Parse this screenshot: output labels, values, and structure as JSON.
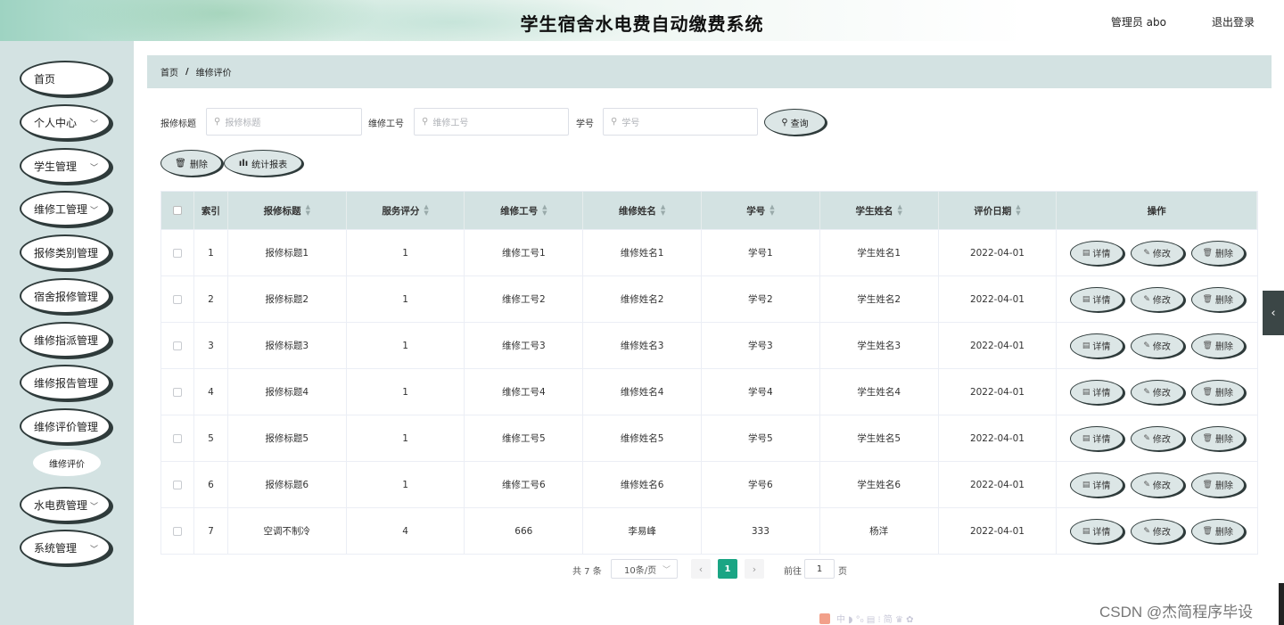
{
  "header": {
    "title": "学生宿舍水电费自动缴费系统",
    "user_label": "管理员 abo",
    "logout_label": "退出登录"
  },
  "sidebar": {
    "items": [
      {
        "label": "首页",
        "has_submenu": false
      },
      {
        "label": "个人中心",
        "has_submenu": true
      },
      {
        "label": "学生管理",
        "has_submenu": true
      },
      {
        "label": "维修工管理",
        "has_submenu": true
      },
      {
        "label": "报修类别管理",
        "has_submenu": false
      },
      {
        "label": "宿舍报修管理",
        "has_submenu": false
      },
      {
        "label": "维修指派管理",
        "has_submenu": false
      },
      {
        "label": "维修报告管理",
        "has_submenu": false
      },
      {
        "label": "维修评价管理",
        "has_submenu": false
      },
      {
        "label": "水电费管理",
        "has_submenu": true
      },
      {
        "label": "系统管理",
        "has_submenu": true
      }
    ],
    "active_subitem": "维修评价"
  },
  "breadcrumb": {
    "home": "首页",
    "separator": "/",
    "current": "维修评价"
  },
  "search": {
    "field1_label": "报修标题",
    "field1_placeholder": "报修标题",
    "field2_label": "维修工号",
    "field2_placeholder": "维修工号",
    "field3_label": "学号",
    "field3_placeholder": "学号",
    "query_button": "查询"
  },
  "toolbar": {
    "delete_button": "删除",
    "report_button": "统计报表"
  },
  "table": {
    "columns": [
      "索引",
      "报修标题",
      "服务评分",
      "维修工号",
      "维修姓名",
      "学号",
      "学生姓名",
      "评价日期",
      "操作"
    ],
    "rows": [
      {
        "index": "1",
        "title": "报修标题1",
        "score": "1",
        "worker_id": "维修工号1",
        "worker_name": "维修姓名1",
        "student_id": "学号1",
        "student_name": "学生姓名1",
        "date": "2022-04-01"
      },
      {
        "index": "2",
        "title": "报修标题2",
        "score": "1",
        "worker_id": "维修工号2",
        "worker_name": "维修姓名2",
        "student_id": "学号2",
        "student_name": "学生姓名2",
        "date": "2022-04-01"
      },
      {
        "index": "3",
        "title": "报修标题3",
        "score": "1",
        "worker_id": "维修工号3",
        "worker_name": "维修姓名3",
        "student_id": "学号3",
        "student_name": "学生姓名3",
        "date": "2022-04-01"
      },
      {
        "index": "4",
        "title": "报修标题4",
        "score": "1",
        "worker_id": "维修工号4",
        "worker_name": "维修姓名4",
        "student_id": "学号4",
        "student_name": "学生姓名4",
        "date": "2022-04-01"
      },
      {
        "index": "5",
        "title": "报修标题5",
        "score": "1",
        "worker_id": "维修工号5",
        "worker_name": "维修姓名5",
        "student_id": "学号5",
        "student_name": "学生姓名5",
        "date": "2022-04-01"
      },
      {
        "index": "6",
        "title": "报修标题6",
        "score": "1",
        "worker_id": "维修工号6",
        "worker_name": "维修姓名6",
        "student_id": "学号6",
        "student_name": "学生姓名6",
        "date": "2022-04-01"
      },
      {
        "index": "7",
        "title": "空调不制冷",
        "score": "4",
        "worker_id": "666",
        "worker_name": "李易峰",
        "student_id": "333",
        "student_name": "杨洋",
        "date": "2022-04-01"
      }
    ],
    "actions": {
      "detail": "详情",
      "edit": "修改",
      "delete": "删除"
    }
  },
  "pagination": {
    "total": "共 7 条",
    "page_size": "10条/页",
    "current_page": "1",
    "goto_label": "前往",
    "goto_value": "1",
    "page_suffix": "页"
  },
  "watermark": "CSDN @杰简程序毕设",
  "ime_toolbar": "中 ◗ °₀ ▤ ⁝ 简 ♛ ✿",
  "colors": {
    "sidebar_bg": "#d3e2e2",
    "button_bg": "#dce6e6",
    "button_border": "#2f3b3b",
    "pager_active": "#1aa584"
  }
}
